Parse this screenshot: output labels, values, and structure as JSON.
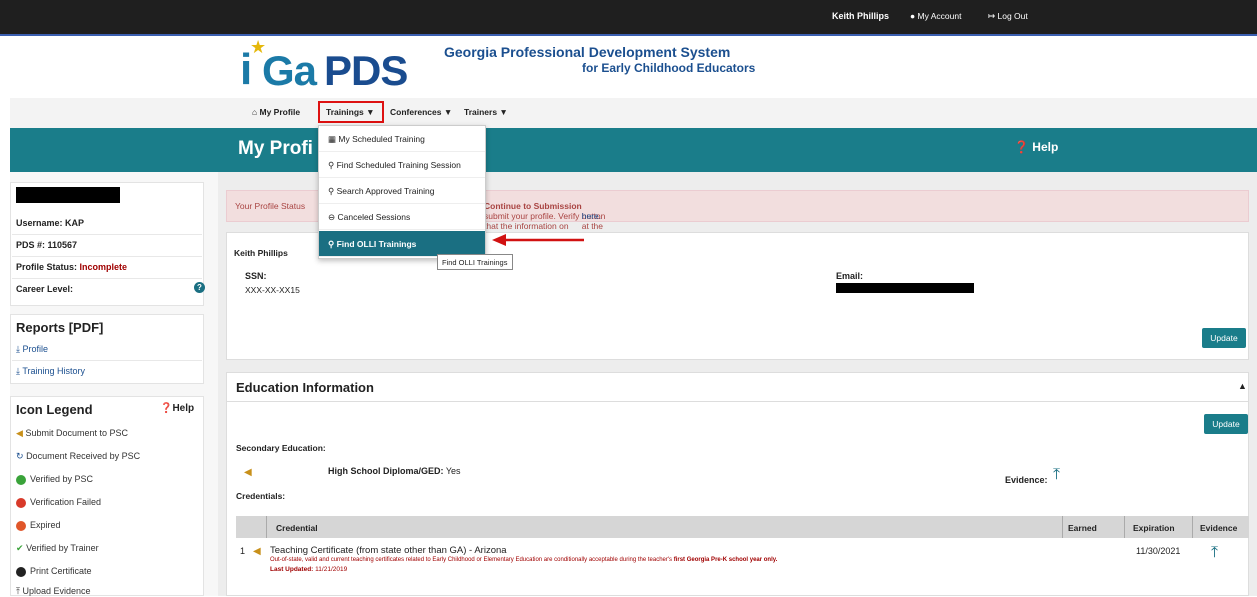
{
  "topbar": {
    "user_name": "Keith Phillips",
    "my_account": "My Account",
    "log_out": "Log Out"
  },
  "header": {
    "logo_i": "i",
    "logo_ga": "Ga",
    "logo_pds": "PDS",
    "title_line1": "Georgia Professional Development System",
    "title_line2": "for Early Childhood Educators"
  },
  "nav": {
    "my_profile": "My Profile",
    "trainings": "Trainings ▼",
    "conferences": "Conferences ▼",
    "trainers": "Trainers ▼"
  },
  "banner": {
    "title": "My Profi",
    "help": "Help"
  },
  "dropdown": {
    "items": [
      "My Scheduled Training",
      "Find Scheduled Training Session",
      "Search Approved Training",
      "Canceled Sessions",
      "Find OLLI Trainings"
    ],
    "tooltip": "Find OLLI Trainings"
  },
  "sidebar": {
    "username_label": "Username: KAP",
    "pds_label": "PDS #: 110567",
    "profile_status_label": "Profile Status:",
    "profile_status_value": "Incomplete",
    "career_level_label": "Career Level:",
    "reports_heading": "Reports [PDF]",
    "reports": [
      "Profile",
      "Training History"
    ],
    "legend_heading": "Icon Legend",
    "legend_help": "Help",
    "legend": [
      "Submit Document to PSC",
      "Document Received by PSC",
      "Verified by PSC",
      "Verification Failed",
      "Expired",
      "Verified by Trainer",
      "Print Certificate",
      "Upload Evidence"
    ]
  },
  "alert": {
    "part1": "Your Profile Status",
    "part2": "submit your profile. Verify that the information on your profile is correct, then click the",
    "part3": "Continue to Submission",
    "part4": "button at the bottom of the page. For help, please click",
    "link": "here."
  },
  "profile_panel": {
    "name": "Keith Phillips",
    "ssn_label": "SSN:",
    "ssn_value": "XXX-XX-XX15",
    "email_label": "Email:",
    "update": "Update"
  },
  "education": {
    "heading": "Education Information",
    "update": "Update",
    "secondary_label": "Secondary Education:",
    "diploma_label": "High School Diploma/GED:",
    "diploma_value": "Yes",
    "evidence_label": "Evidence:",
    "credentials_label": "Credentials:",
    "table_headers": [
      "Credential",
      "Earned",
      "Expiration",
      "Evidence"
    ],
    "row_index": "1",
    "row_credential": "Teaching Certificate (from state other than GA) - Arizona",
    "row_note_start": "Out-of-state, valid and current teaching certificates related to Early Childhood or Elementary Education are conditionally acceptable during the teacher's",
    "row_note_bold": "first Georgia Pre-K school year only.",
    "row_last_updated_label": "Last Updated:",
    "row_last_updated": "11/21/2019",
    "row_expiration": "11/30/2021"
  },
  "colors": {
    "teal": "#1a7d8a",
    "incomplete_red": "#a00000",
    "highlight_red": "#d11111"
  }
}
